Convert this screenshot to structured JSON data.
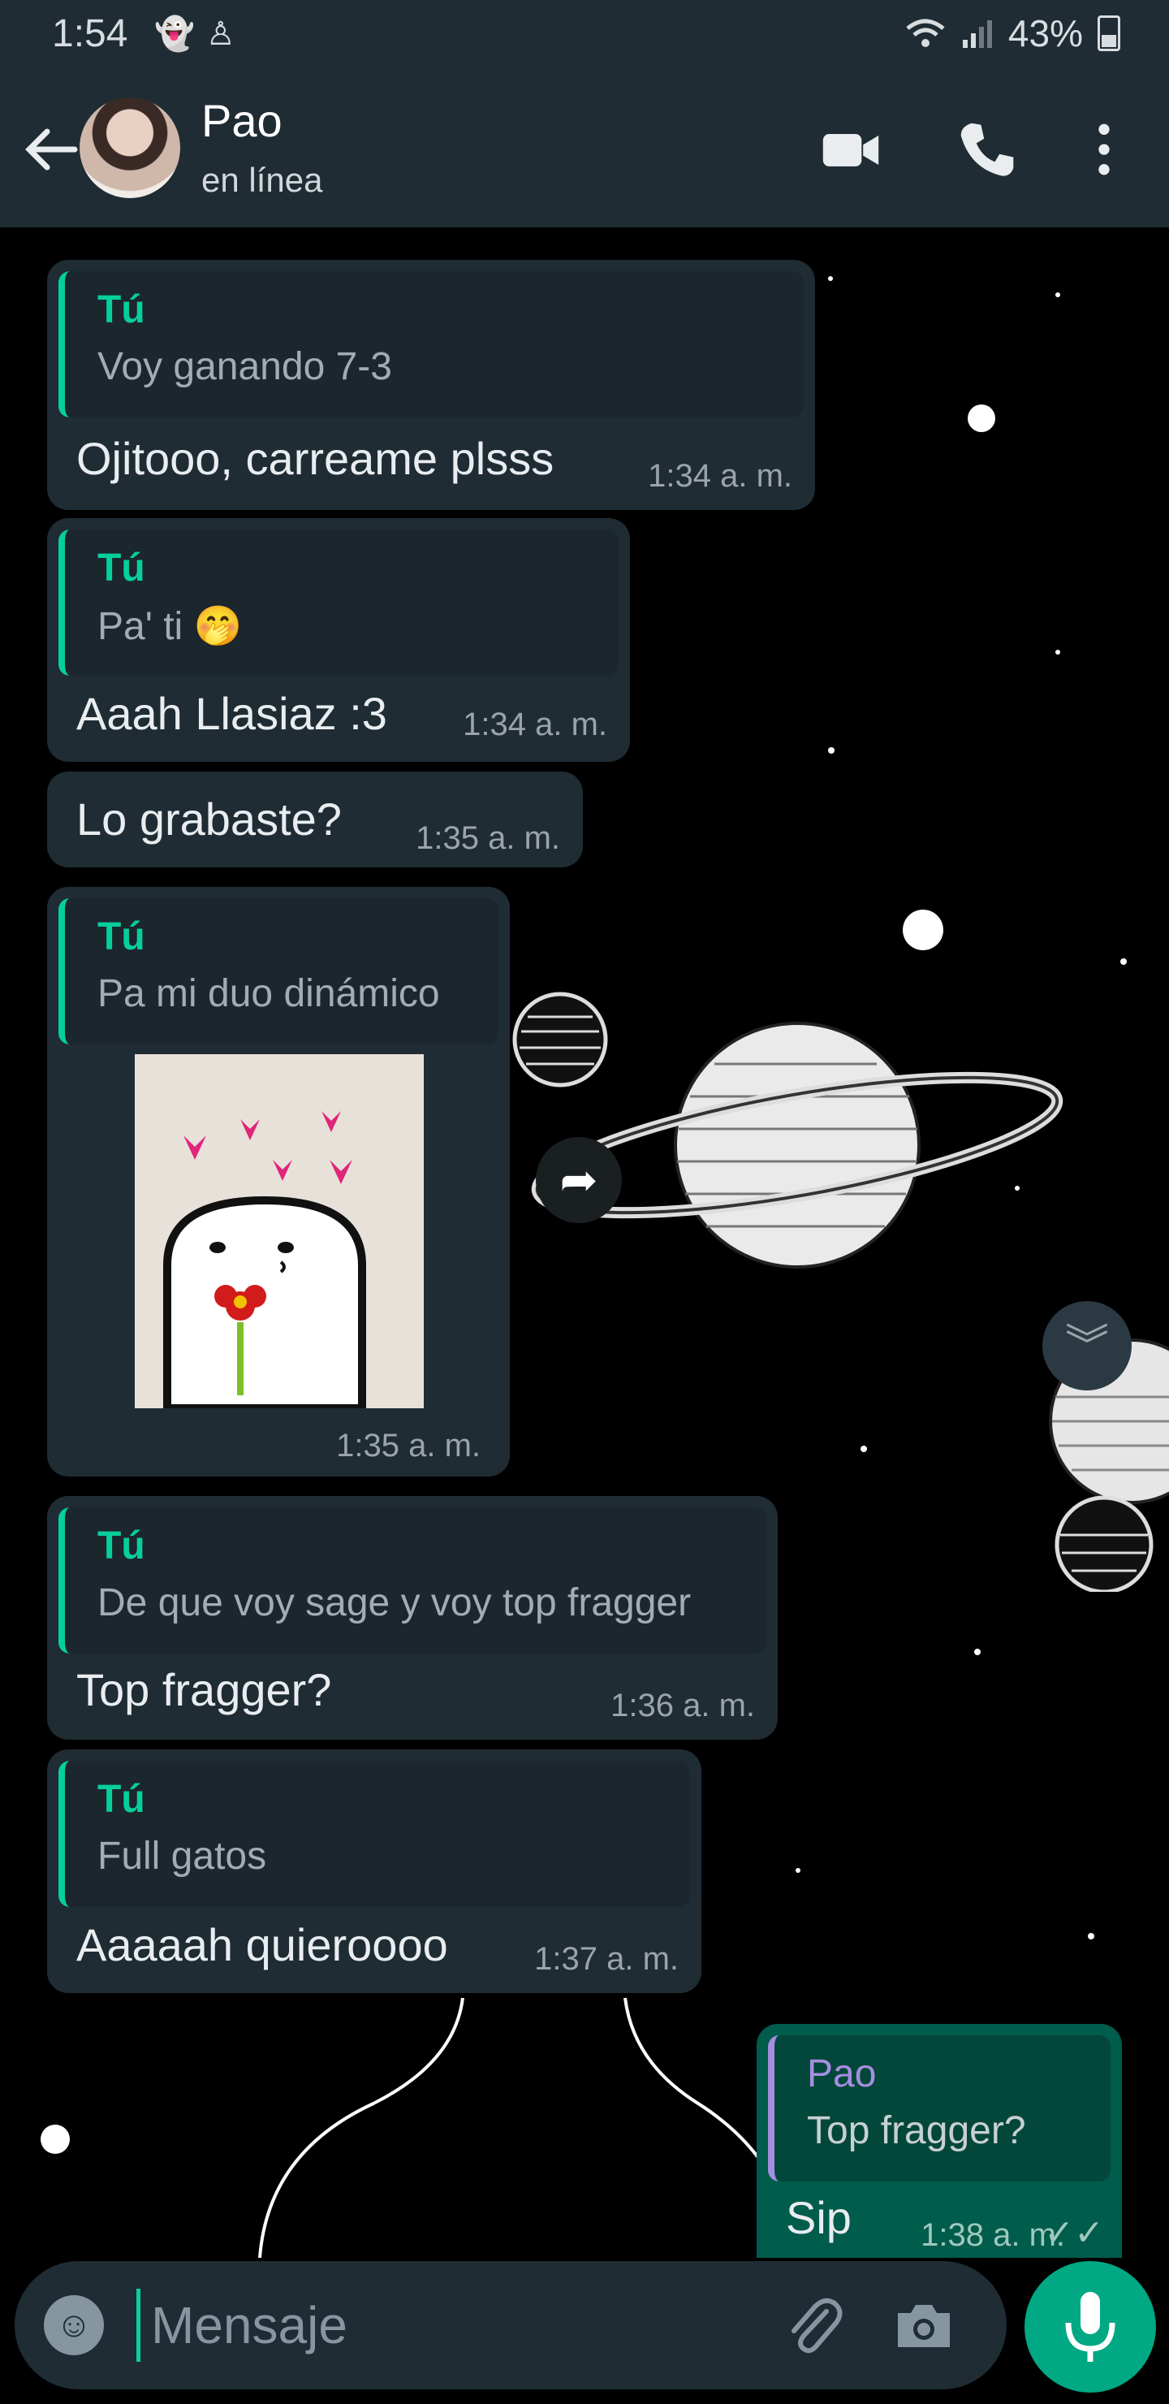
{
  "status_bar": {
    "time": "1:54",
    "battery": "43%"
  },
  "header": {
    "name": "Pao",
    "status": "en línea"
  },
  "messages": [
    {
      "quote_name": "Tú",
      "quote_text": "Voy ganando 7-3",
      "text": "Ojitooo, carreame plsss",
      "time": "1:34 a. m."
    },
    {
      "quote_name": "Tú",
      "quote_text": "Pa' ti 🤭",
      "text": "Aaah Llasiaz :3",
      "time": "1:34 a. m."
    },
    {
      "text": "Lo grabaste?",
      "time": "1:35 a. m."
    },
    {
      "quote_name": "Tú",
      "quote_text": "Pa mi duo dinámico",
      "sticker": "flork-sticker",
      "time": "1:35 a. m."
    },
    {
      "quote_name": "Tú",
      "quote_text": "De que voy sage y voy top fragger",
      "text": "Top fragger?",
      "time": "1:36 a. m."
    },
    {
      "quote_name": "Tú",
      "quote_text": "Full gatos",
      "text": "Aaaaah quieroooo",
      "time": "1:37 a. m."
    },
    {
      "quote_name": "Pao",
      "quote_text": "Top fragger?",
      "text": "Sip",
      "time": "1:38 a. m."
    }
  ],
  "input": {
    "placeholder": "Mensaje"
  },
  "icons": {
    "back": "arrow-left-icon",
    "video": "video-call-icon",
    "call": "phone-icon",
    "menu": "more-vert-icon",
    "emoji": "emoji-icon",
    "attach": "paperclip-icon",
    "camera": "camera-icon",
    "mic": "microphone-icon",
    "forward": "forward-icon",
    "scroll": "double-chevron-down-icon"
  },
  "colors": {
    "accent": "#00a884",
    "header": "#1f2c34",
    "incoming": "#1f2c34",
    "outgoing": "#005c4b",
    "quote_accent": "#06cf9c"
  }
}
